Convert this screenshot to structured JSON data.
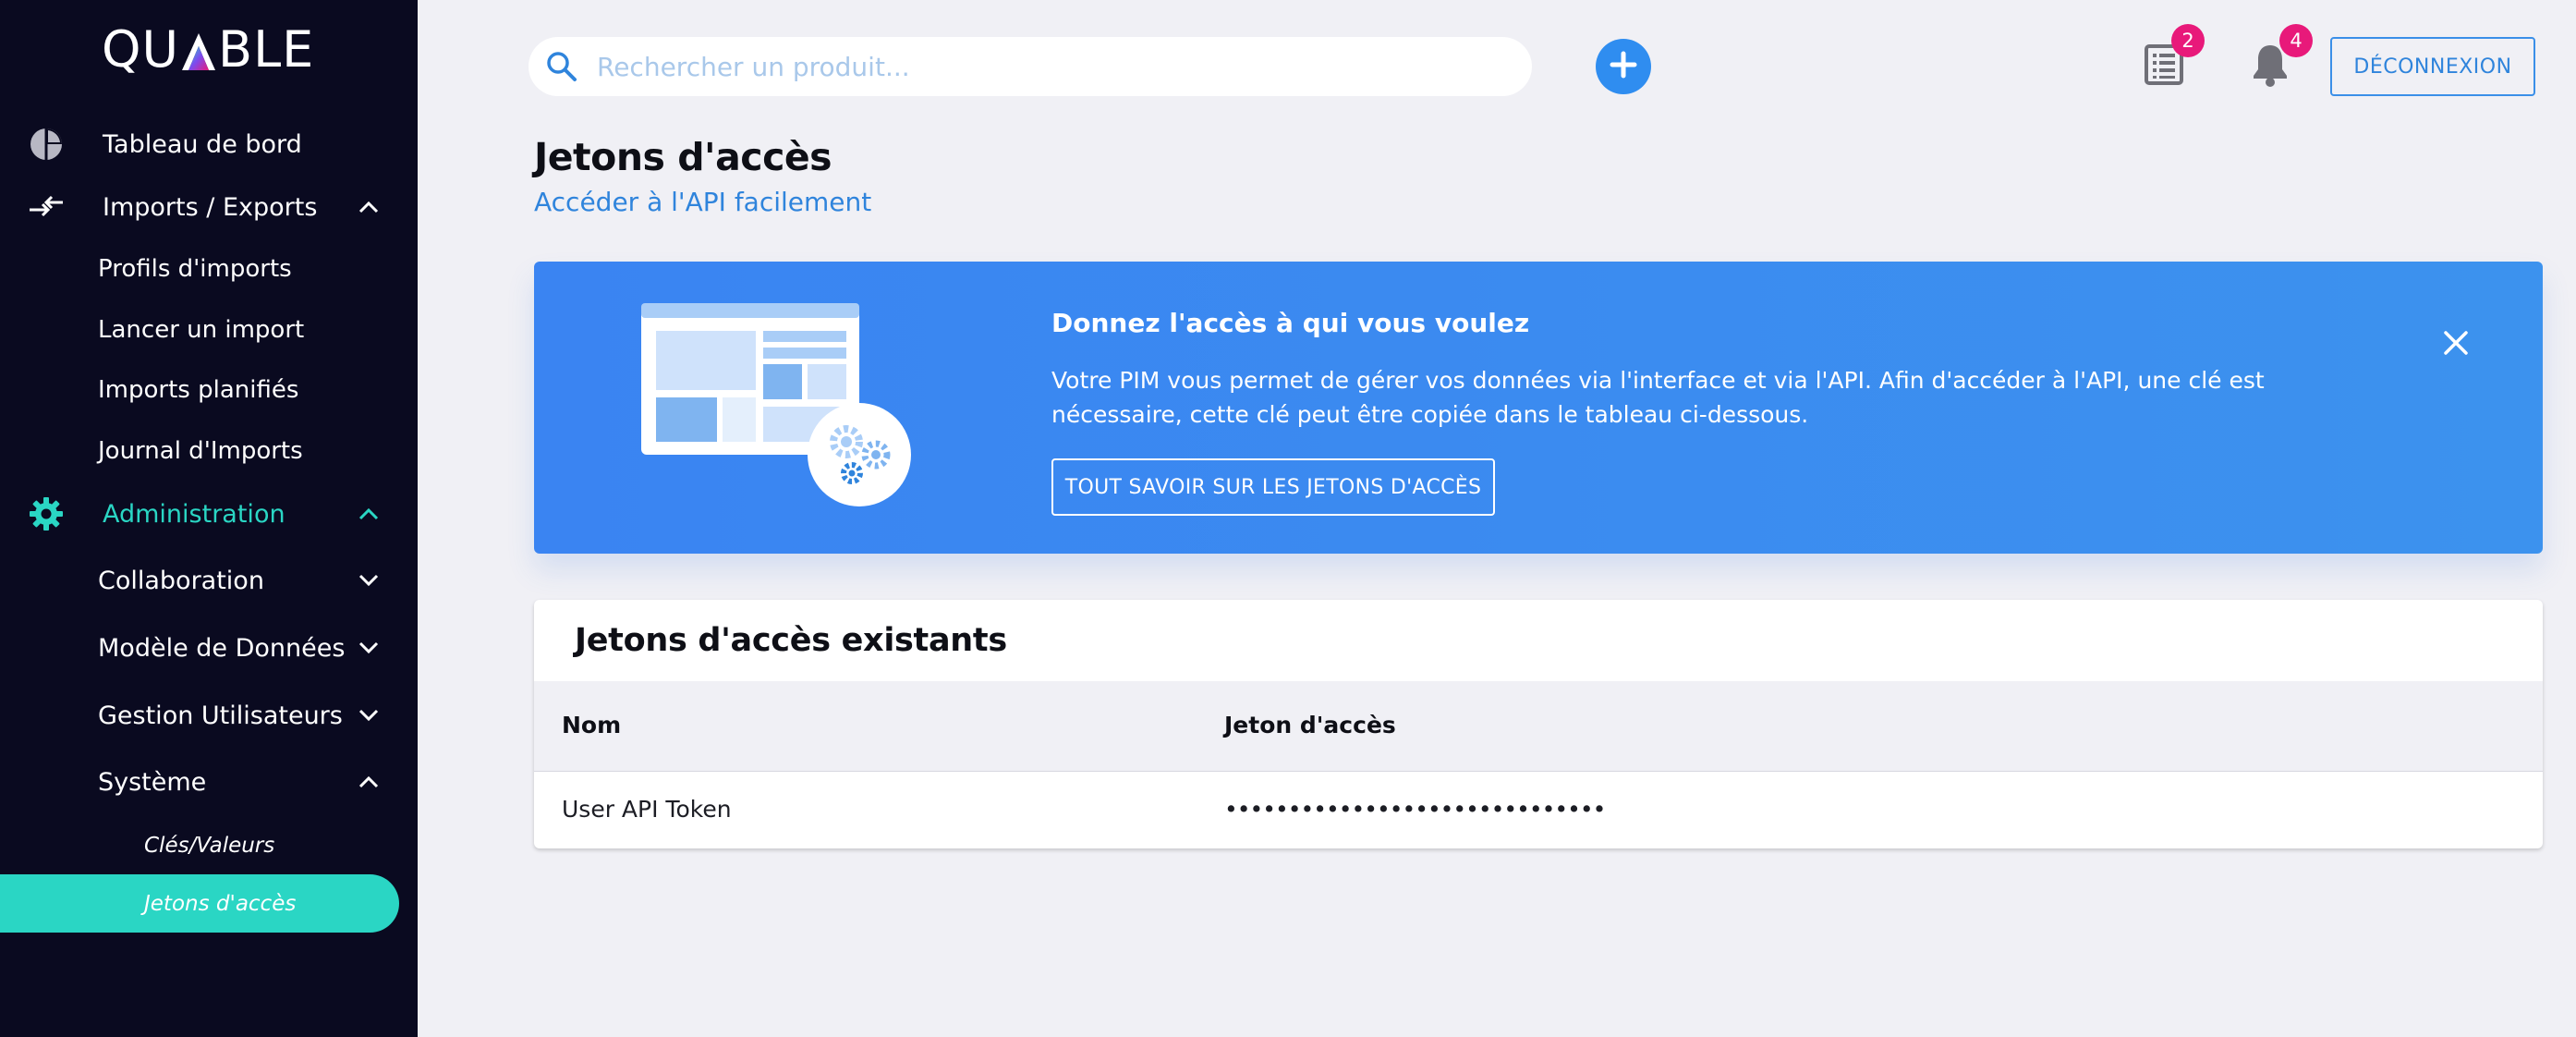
{
  "app": {
    "logo_text_left": "QU",
    "logo_text_right": "BLE",
    "logo_letter": "A"
  },
  "sidebar": {
    "items": [
      {
        "label": "Tableau de bord",
        "icon": "pie-chart-icon"
      },
      {
        "label": "Imports / Exports",
        "icon": "arrows-icon",
        "expanded": true,
        "children": [
          "Profils d'imports",
          "Lancer un import",
          "Imports planifiés",
          "Journal d'Imports"
        ]
      },
      {
        "label": "Administration",
        "icon": "gear-icon",
        "expanded": true,
        "active": true,
        "children": [
          {
            "label": "Collaboration",
            "expanded": false
          },
          {
            "label": "Modèle de Données",
            "expanded": false
          },
          {
            "label": "Gestion Utilisateurs",
            "expanded": false
          },
          {
            "label": "Système",
            "expanded": true,
            "children": [
              "Clés/Valeurs",
              "Jetons d'accès"
            ]
          }
        ]
      }
    ]
  },
  "topbar": {
    "search_placeholder": "Rechercher un produit...",
    "tasks_badge": "2",
    "notifications_badge": "4",
    "logout_label": "DÉCONNEXION"
  },
  "page": {
    "title": "Jetons d'accès",
    "subtitle": "Accéder à l'API facilement"
  },
  "banner": {
    "title": "Donnez l'accès à qui vous voulez",
    "text": "Votre PIM vous permet de gérer vos données via l'interface et via l'API. Afin d'accéder à l'API, une clé est nécessaire, cette clé peut être copiée dans le tableau ci-dessous.",
    "button_label": "TOUT SAVOIR SUR LES JETONS D'ACCÈS"
  },
  "tokens": {
    "title": "Jetons d'accès existants",
    "columns": [
      "Nom",
      "Jeton d'accès"
    ],
    "rows": [
      {
        "name": "User API Token",
        "token": "••••••••••••••••••••••••••••••"
      }
    ]
  },
  "colors": {
    "sidebar_bg": "#0a0a20",
    "accent_teal": "#2ad6c4",
    "primary_blue": "#2f8df0",
    "badge_pink": "#e8197a",
    "page_bg": "#f0f0f5"
  }
}
